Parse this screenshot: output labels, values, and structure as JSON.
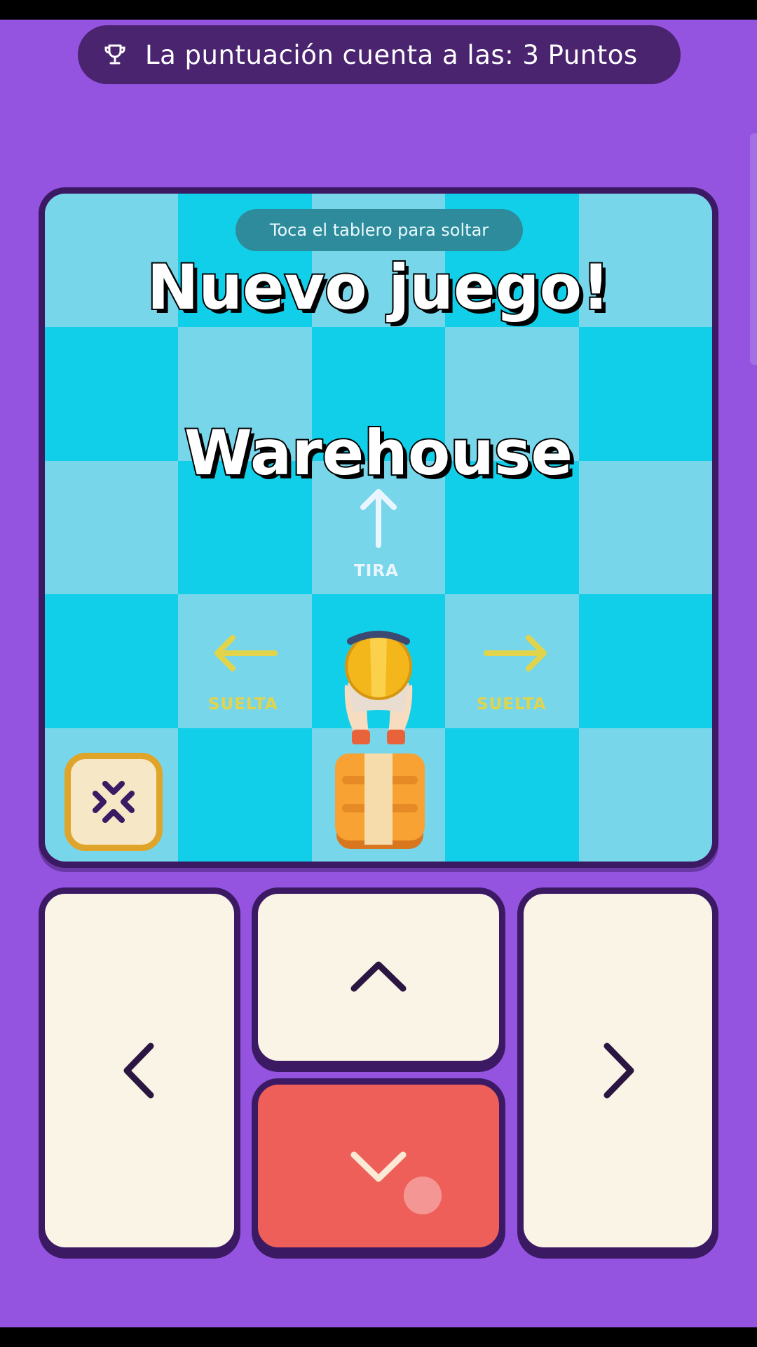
{
  "score_banner": {
    "icon": "trophy-icon",
    "text": "La puntuación cuenta a las: 3 Puntos"
  },
  "board": {
    "hint": "Toca el tablero para soltar",
    "title_line1": "Nuevo juego!",
    "title_line2": "Warehouse",
    "pull_label": "TIRA",
    "release_left_label": "SUELTA",
    "release_right_label": "SUELTA",
    "colors": {
      "light_tile": "#78d6ea",
      "dark_tile": "#11cfe9",
      "pull": "#eaf6ff",
      "release": "#e2d44a"
    }
  },
  "controls": {
    "left_icon": "chevron-left-icon",
    "up_icon": "chevron-up-icon",
    "down_icon": "chevron-down-icon",
    "right_icon": "chevron-right-icon",
    "shrink_icon": "collapse-arrows-icon",
    "down_color": "#ef5f5a"
  }
}
